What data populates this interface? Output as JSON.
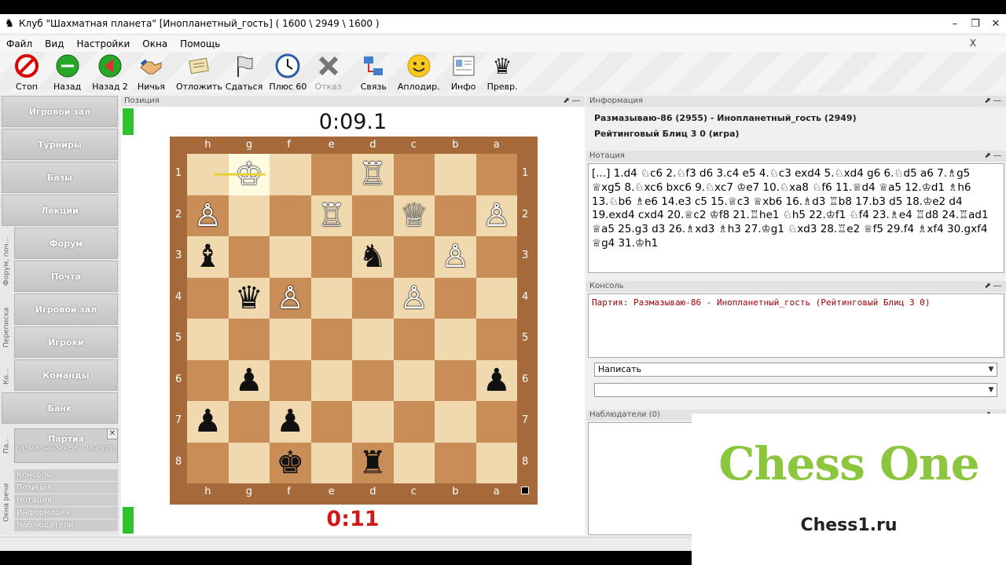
{
  "window": {
    "title": "Клуб \"Шахматная планета\" [Инопланетный_гость]  ( 1600 \\ 2949 \\ 1600 )",
    "min": "–",
    "max": "❐",
    "close": "✕"
  },
  "menu": {
    "items": [
      "Файл",
      "Вид",
      "Настройки",
      "Окна",
      "Помощь"
    ],
    "close": "X"
  },
  "toolbar": [
    {
      "label": "Стоп",
      "icon": "stop-icon",
      "enabled": true
    },
    {
      "label": "Назад",
      "icon": "back-icon",
      "enabled": true
    },
    {
      "label": "Назад 2",
      "icon": "back2-icon",
      "enabled": true
    },
    {
      "label": "Ничья",
      "icon": "draw-handshake-icon",
      "enabled": true
    },
    {
      "label": "Отложить",
      "icon": "adjourn-icon",
      "enabled": true
    },
    {
      "label": "Сдаться",
      "icon": "resign-flag-icon",
      "enabled": true
    },
    {
      "label": "Плюс 60",
      "icon": "clock-icon",
      "enabled": true
    },
    {
      "label": "Отказ",
      "icon": "refuse-icon",
      "enabled": false
    },
    {
      "label": "Связь",
      "icon": "connection-icon",
      "enabled": true
    },
    {
      "label": "Аплодир.",
      "icon": "smiley-icon",
      "enabled": true
    },
    {
      "label": "Инфо",
      "icon": "info-icon",
      "enabled": true
    },
    {
      "label": "Превр.",
      "icon": "promotion-queen-icon",
      "enabled": true
    }
  ],
  "nav": {
    "items": [
      "Игровой зал",
      "Турниры",
      "Базы",
      "Лекции",
      "Форум",
      "Почта",
      "Игровой зал",
      "Игроки",
      "Команды",
      "Банк"
    ],
    "vertical_tabs": [
      "Форум, поч...",
      "Переписка",
      "Ко...",
      "Па...",
      "Окна речи"
    ],
    "party": {
      "title": "Партия",
      "subtitle": "Размазываю-86 - Инопл...",
      "close": "✕"
    },
    "subitems": [
      "Консоль",
      "Позиция",
      "Нотация",
      "Информация",
      "Наблюдатели"
    ]
  },
  "position_panel": {
    "header": "Позиция",
    "top_clock": "0:09.1",
    "bottom_clock": "0:11",
    "files": [
      "h",
      "g",
      "f",
      "e",
      "d",
      "c",
      "b",
      "a"
    ],
    "ranks": [
      "1",
      "2",
      "3",
      "4",
      "5",
      "6",
      "7",
      "8"
    ],
    "pieces": [
      {
        "sq": "g1",
        "glyph": "♔",
        "side": "white"
      },
      {
        "sq": "d1",
        "glyph": "♖",
        "side": "white"
      },
      {
        "sq": "h2",
        "glyph": "♙",
        "side": "white"
      },
      {
        "sq": "e2",
        "glyph": "♖",
        "side": "white"
      },
      {
        "sq": "c2",
        "glyph": "♕",
        "side": "white"
      },
      {
        "sq": "a2",
        "glyph": "♙",
        "side": "white"
      },
      {
        "sq": "h3",
        "glyph": "♝",
        "side": "black"
      },
      {
        "sq": "d3",
        "glyph": "♞",
        "side": "black"
      },
      {
        "sq": "b3",
        "glyph": "♙",
        "side": "white"
      },
      {
        "sq": "g4",
        "glyph": "♛",
        "side": "black"
      },
      {
        "sq": "f4",
        "glyph": "♙",
        "side": "white"
      },
      {
        "sq": "c4",
        "glyph": "♙",
        "side": "white"
      },
      {
        "sq": "g6",
        "glyph": "♟",
        "side": "black"
      },
      {
        "sq": "a6",
        "glyph": "♟",
        "side": "black"
      },
      {
        "sq": "h7",
        "glyph": "♟",
        "side": "black"
      },
      {
        "sq": "f7",
        "glyph": "♟",
        "side": "black"
      },
      {
        "sq": "f8",
        "glyph": "♚",
        "side": "black"
      },
      {
        "sq": "d8",
        "glyph": "♜",
        "side": "black"
      }
    ],
    "last_move_from": "g1",
    "last_move_to": "h1"
  },
  "info_panel": {
    "header": "Информация",
    "players": "Размазываю-86 (2955) - Инопланетный_гость (2949)",
    "game_type": "Рейтинговый Блиц 3 0  (игра)"
  },
  "notation_panel": {
    "header": "Нотация",
    "text": "[...] 1.d4 ♘c6 2.♘f3 d6 3.c4 e5 4.♘c3 exd4 5.♘xd4 g6 6.♘d5 a6 7.♗g5 ♕xg5 8.♘xc6 bxc6 9.♘xc7 ♔e7 10.♘xa8 ♘f6 11.♕d4 ♕a5 12.♔d1 ♗h6 13.♘b6 ♗e6 14.e3 c5 15.♕c3 ♕xb6 16.♗d3 ♖b8 17.b3 d5 18.♔e2 d4 19.exd4 cxd4 20.♕c2 ♔f8 21.♖he1 ♘h5 22.♔f1 ♘f4 23.♗e4 ♖d8 24.♖ad1 ♕a5 25.g3 d3 26.♗xd3 ♗h3 27.♔g1 ♘xd3 28.♖e2 ♕f5 29.f4 ♗xf4 30.gxf4 ♕g4 31.♔h1"
  },
  "console_panel": {
    "header": "Консоль",
    "line": "Партия: Размазываю-86 - Инопланетный_гость (Рейтинговый Блиц 3 0)",
    "combo1": "Написать",
    "combo2": ""
  },
  "observers_panel": {
    "header": "Наблюдатели (0)"
  },
  "promo": {
    "brand": "Chess One",
    "site": "Chess1.ru"
  },
  "colors": {
    "light_square": "#f0d9ae",
    "dark_square": "#c98e57",
    "clock_low": "#d01818",
    "brand_green": "#8cc63f"
  }
}
